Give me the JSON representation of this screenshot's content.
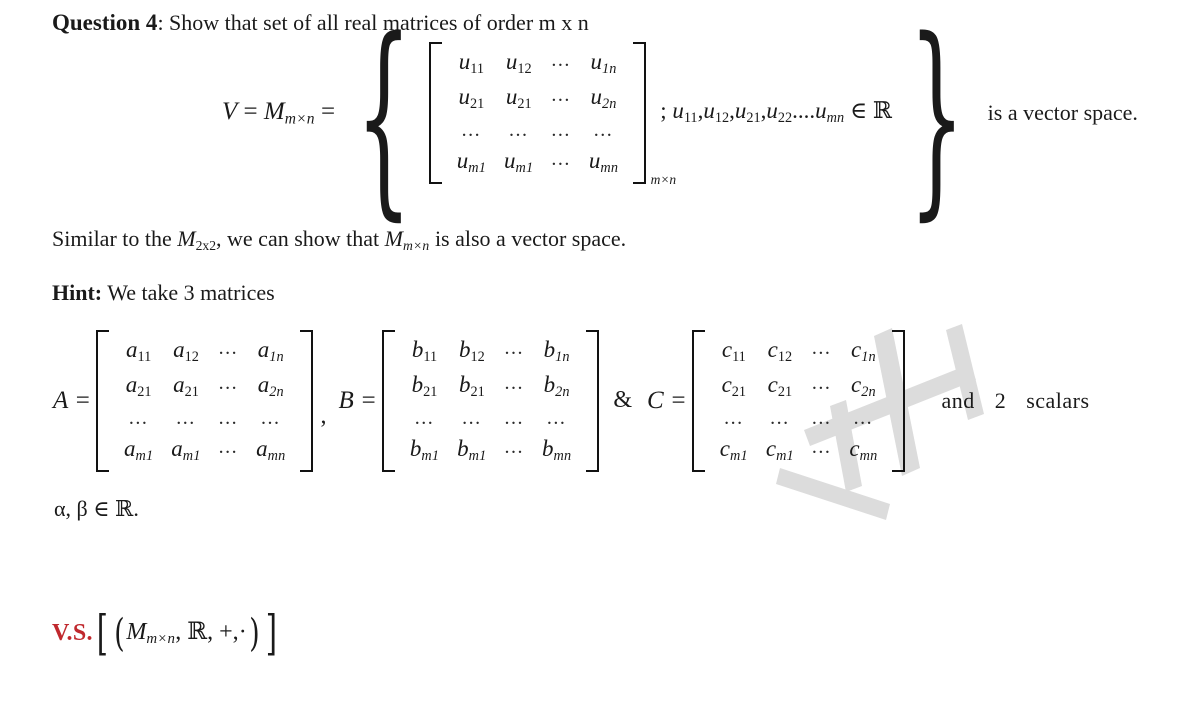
{
  "document": {
    "background_color": "#ffffff",
    "text_color": "#1a1a1a",
    "accent_color": "#c0282d",
    "watermark_color": "#d9d9d9"
  },
  "question": {
    "label": "Question 4",
    "text": ": Show that set of all real matrices of order m x n"
  },
  "definition": {
    "lead_v": "V",
    "lead_eq1": " = ",
    "lead_m": "M",
    "lead_m_sub": "m×n",
    "lead_eq2": " =",
    "matrix": {
      "subscript": "m×n",
      "rows": [
        [
          "u11",
          "u12",
          "...",
          "u1n"
        ],
        [
          "u21",
          "u21",
          "...",
          "u2n"
        ],
        [
          "...",
          "...",
          "...",
          "..."
        ],
        [
          "um1",
          "um1",
          "...",
          "umn"
        ]
      ],
      "cells": [
        [
          {
            "base": "u",
            "sub": "11"
          },
          {
            "base": "u",
            "sub": "12"
          },
          {
            "dots": "..."
          },
          {
            "base": "u",
            "sub": "1n"
          }
        ],
        [
          {
            "base": "u",
            "sub": "21"
          },
          {
            "base": "u",
            "sub": "21"
          },
          {
            "dots": "..."
          },
          {
            "base": "u",
            "sub": "2n"
          }
        ],
        [
          {
            "dots": "..."
          },
          {
            "dots": "..."
          },
          {
            "dots": "..."
          },
          {
            "dots": "..."
          }
        ],
        [
          {
            "base": "u",
            "sub": "m1"
          },
          {
            "base": "u",
            "sub": "m1"
          },
          {
            "dots": "..."
          },
          {
            "base": "u",
            "sub": "mn"
          }
        ]
      ]
    },
    "condition_prefix": ";",
    "condition_terms": [
      "u11",
      "u12",
      "u21",
      "u22",
      "....umn"
    ],
    "condition_membership": "∈",
    "condition_set": "ℝ",
    "tail_text": "is a vector space."
  },
  "similar": {
    "part1": "Similar to the ",
    "m1": "M",
    "m1_sub": "2x2",
    "part2": ", we can show that ",
    "m2": "M",
    "m2_sub": "m×n",
    "part3": " is also a vector space."
  },
  "hint": {
    "label": "Hint:",
    "text": " We take 3 matrices"
  },
  "matrices": [
    {
      "name": "A",
      "eq": "A =",
      "letter": "a",
      "cells": [
        [
          {
            "base": "a",
            "sub": "11"
          },
          {
            "base": "a",
            "sub": "12"
          },
          {
            "dots": "..."
          },
          {
            "base": "a",
            "sub": "1n"
          }
        ],
        [
          {
            "base": "a",
            "sub": "21"
          },
          {
            "base": "a",
            "sub": "21"
          },
          {
            "dots": "..."
          },
          {
            "base": "a",
            "sub": "2n"
          }
        ],
        [
          {
            "dots": "..."
          },
          {
            "dots": "..."
          },
          {
            "dots": "..."
          },
          {
            "dots": "..."
          }
        ],
        [
          {
            "base": "a",
            "sub": "m1"
          },
          {
            "base": "a",
            "sub": "m1"
          },
          {
            "dots": "..."
          },
          {
            "base": "a",
            "sub": "mn"
          }
        ]
      ]
    },
    {
      "name": "B",
      "eq": "B =",
      "letter": "b",
      "cells": [
        [
          {
            "base": "b",
            "sub": "11"
          },
          {
            "base": "b",
            "sub": "12"
          },
          {
            "dots": "..."
          },
          {
            "base": "b",
            "sub": "1n"
          }
        ],
        [
          {
            "base": "b",
            "sub": "21"
          },
          {
            "base": "b",
            "sub": "21"
          },
          {
            "dots": "..."
          },
          {
            "base": "b",
            "sub": "2n"
          }
        ],
        [
          {
            "dots": "..."
          },
          {
            "dots": "..."
          },
          {
            "dots": "..."
          },
          {
            "dots": "..."
          }
        ],
        [
          {
            "base": "b",
            "sub": "m1"
          },
          {
            "base": "b",
            "sub": "m1"
          },
          {
            "dots": "..."
          },
          {
            "base": "b",
            "sub": "mn"
          }
        ]
      ]
    },
    {
      "name": "C",
      "eq": "C =",
      "letter": "c",
      "cells": [
        [
          {
            "base": "c",
            "sub": "11"
          },
          {
            "base": "c",
            "sub": "12"
          },
          {
            "dots": "..."
          },
          {
            "base": "c",
            "sub": "1n"
          }
        ],
        [
          {
            "base": "c",
            "sub": "21"
          },
          {
            "base": "c",
            "sub": "21"
          },
          {
            "dots": "..."
          },
          {
            "base": "c",
            "sub": "2n"
          }
        ],
        [
          {
            "dots": "..."
          },
          {
            "dots": "..."
          },
          {
            "dots": "..."
          },
          {
            "dots": "..."
          }
        ],
        [
          {
            "base": "c",
            "sub": "m1"
          },
          {
            "base": "c",
            "sub": "m1"
          },
          {
            "dots": "..."
          },
          {
            "base": "c",
            "sub": "mn"
          }
        ]
      ]
    }
  ],
  "separators": {
    "comma": ",",
    "ampersand": "&"
  },
  "tail": {
    "and": "and",
    "count": "2",
    "scalars": "scalars"
  },
  "scalars_line": {
    "alpha": "α",
    "comma": ", ",
    "beta": "β",
    "membership": " ∈ ",
    "set": "ℝ",
    "period": "."
  },
  "vs": {
    "label": "V.S.",
    "open_bracket": "[",
    "open_paren": "(",
    "m": "M",
    "m_sub": "m×n",
    "comma1": ", ",
    "set": "ℝ",
    "comma2": ", ",
    "plus": "+,",
    "dot": "·",
    "close_paren": ")",
    "close_bracket": "]"
  }
}
